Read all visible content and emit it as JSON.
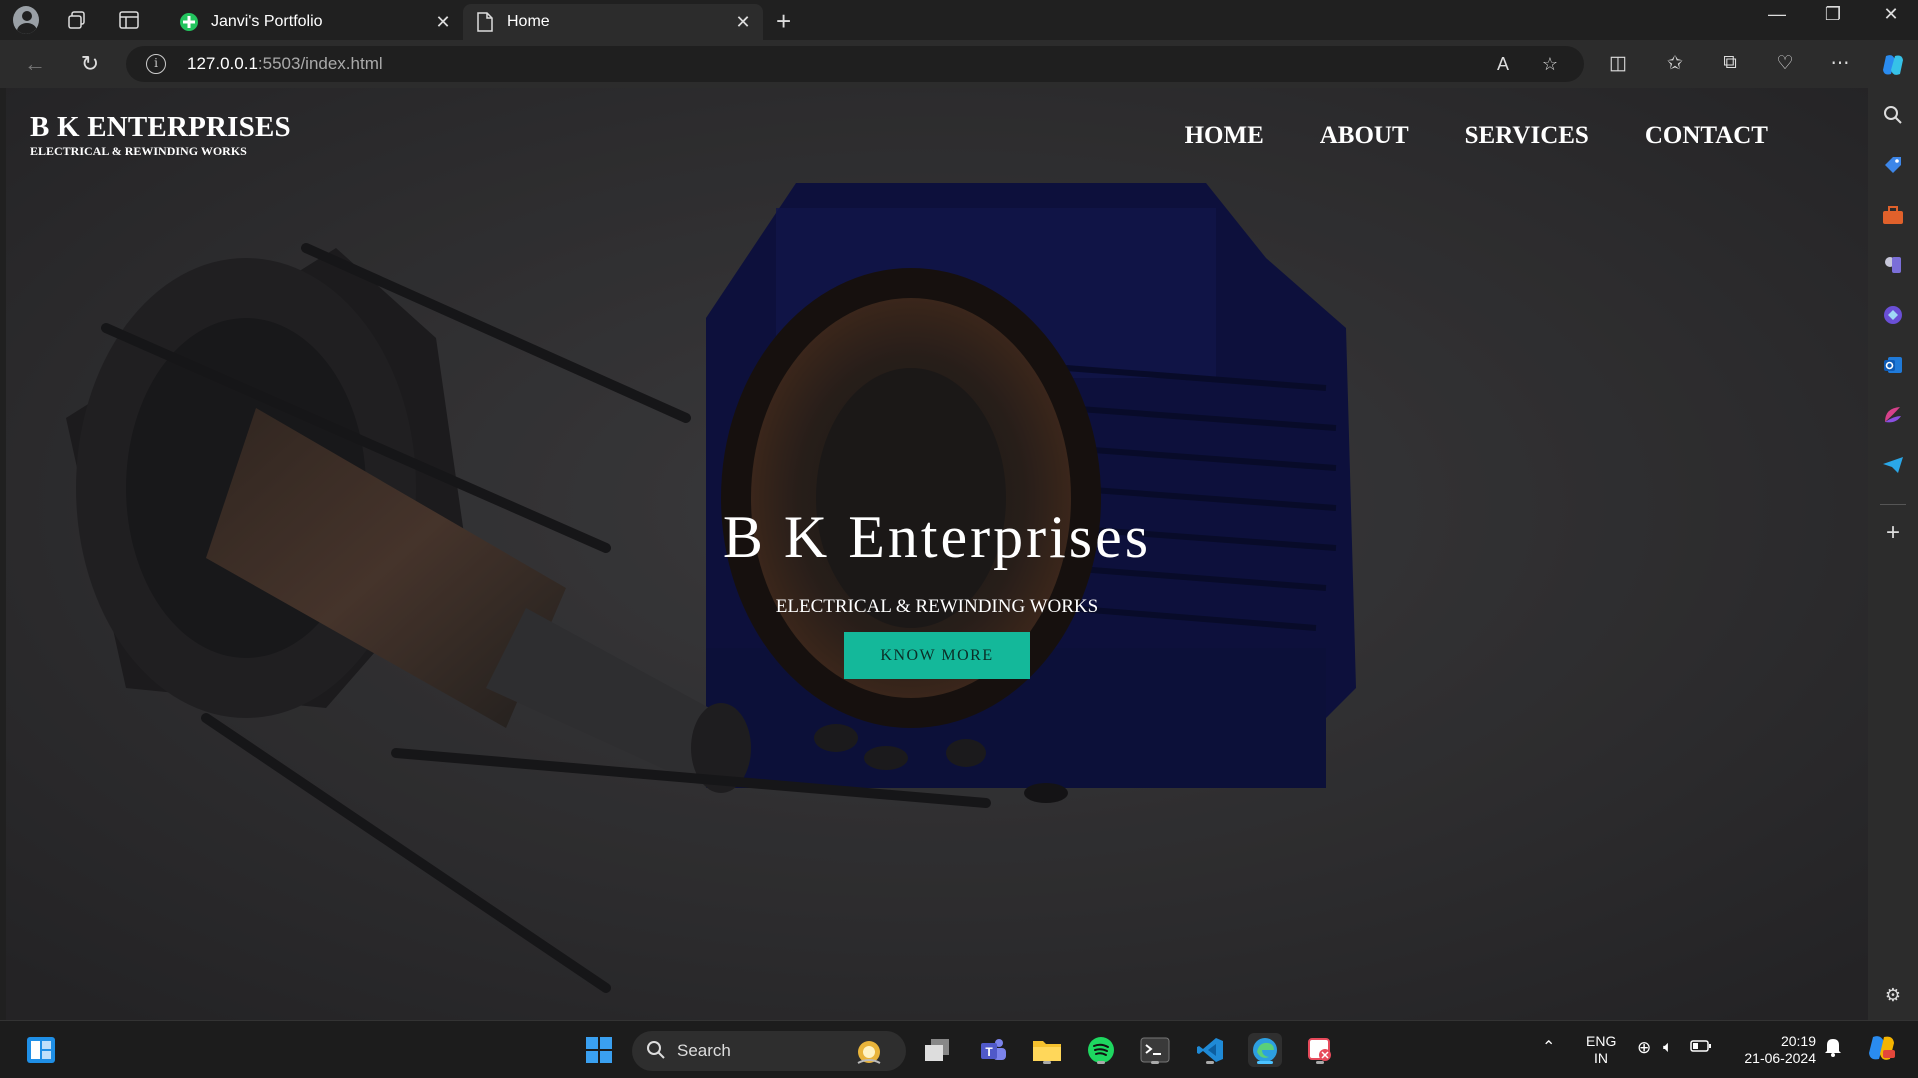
{
  "browser": {
    "tabs": [
      {
        "title": "Janvi's Portfolio"
      },
      {
        "title": "Home"
      }
    ],
    "address": {
      "host": "127.0.0.1",
      "rest": ":5503/index.html"
    }
  },
  "site": {
    "brand_title": "B K ENTERPRISES",
    "brand_subtitle": "ELECTRICAL & REWINDING WORKS",
    "nav": [
      "HOME",
      "ABOUT",
      "SERVICES",
      "CONTACT"
    ],
    "hero_title": "B K Enterprises",
    "hero_subtitle": "ELECTRICAL & REWINDING WORKS",
    "cta": "KNOW MORE"
  },
  "taskbar": {
    "search_label": "Search",
    "lang_top": "ENG",
    "lang_bottom": "IN",
    "time": "20:19",
    "date": "21-06-2024"
  }
}
